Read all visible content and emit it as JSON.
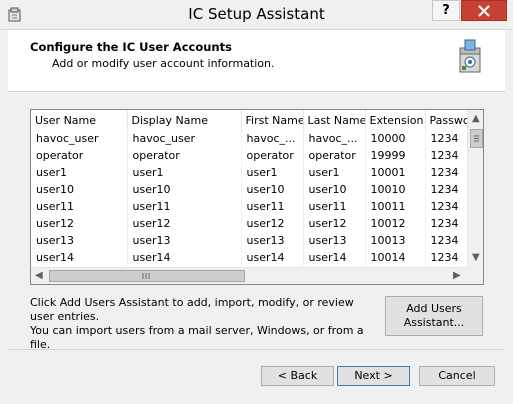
{
  "window": {
    "title": "IC Setup Assistant",
    "help_label": "?"
  },
  "header": {
    "title": "Configure the IC User Accounts",
    "subtitle": "Add or modify user account information."
  },
  "grid": {
    "columns": [
      "User Name",
      "Display Name",
      "First Name",
      "Last Name",
      "Extension",
      "Passwo"
    ],
    "rows": [
      [
        "havoc_user",
        "havoc_user",
        "havoc_...",
        "havoc_...",
        "10000",
        "1234"
      ],
      [
        "operator",
        "operator",
        "operator",
        "operator",
        "19999",
        "1234"
      ],
      [
        "user1",
        "user1",
        "user1",
        "user1",
        "10001",
        "1234"
      ],
      [
        "user10",
        "user10",
        "user10",
        "user10",
        "10010",
        "1234"
      ],
      [
        "user11",
        "user11",
        "user11",
        "user11",
        "10011",
        "1234"
      ],
      [
        "user12",
        "user12",
        "user12",
        "user12",
        "10012",
        "1234"
      ],
      [
        "user13",
        "user13",
        "user13",
        "user13",
        "10013",
        "1234"
      ],
      [
        "user14",
        "user14",
        "user14",
        "user14",
        "10014",
        "1234"
      ]
    ]
  },
  "info": {
    "line1": "Click Add Users Assistant to add, import, modify, or review user entries.",
    "line2": "You can import users from a mail server, Windows, or from a file."
  },
  "buttons": {
    "add_users_line1": "Add Users",
    "add_users_line2": "Assistant...",
    "back": "< Back",
    "next": "Next >",
    "cancel": "Cancel"
  },
  "colors": {
    "close_button": "#c74232",
    "accent": "#3c7fb1"
  },
  "icons": {
    "app": "setup-app-icon",
    "wizard": "setup-box-icon",
    "close": "close-icon",
    "scroll_up": "scroll-up-arrow-icon",
    "scroll_down": "scroll-down-arrow-icon",
    "scroll_left": "scroll-left-arrow-icon",
    "scroll_right": "scroll-right-arrow-icon"
  }
}
